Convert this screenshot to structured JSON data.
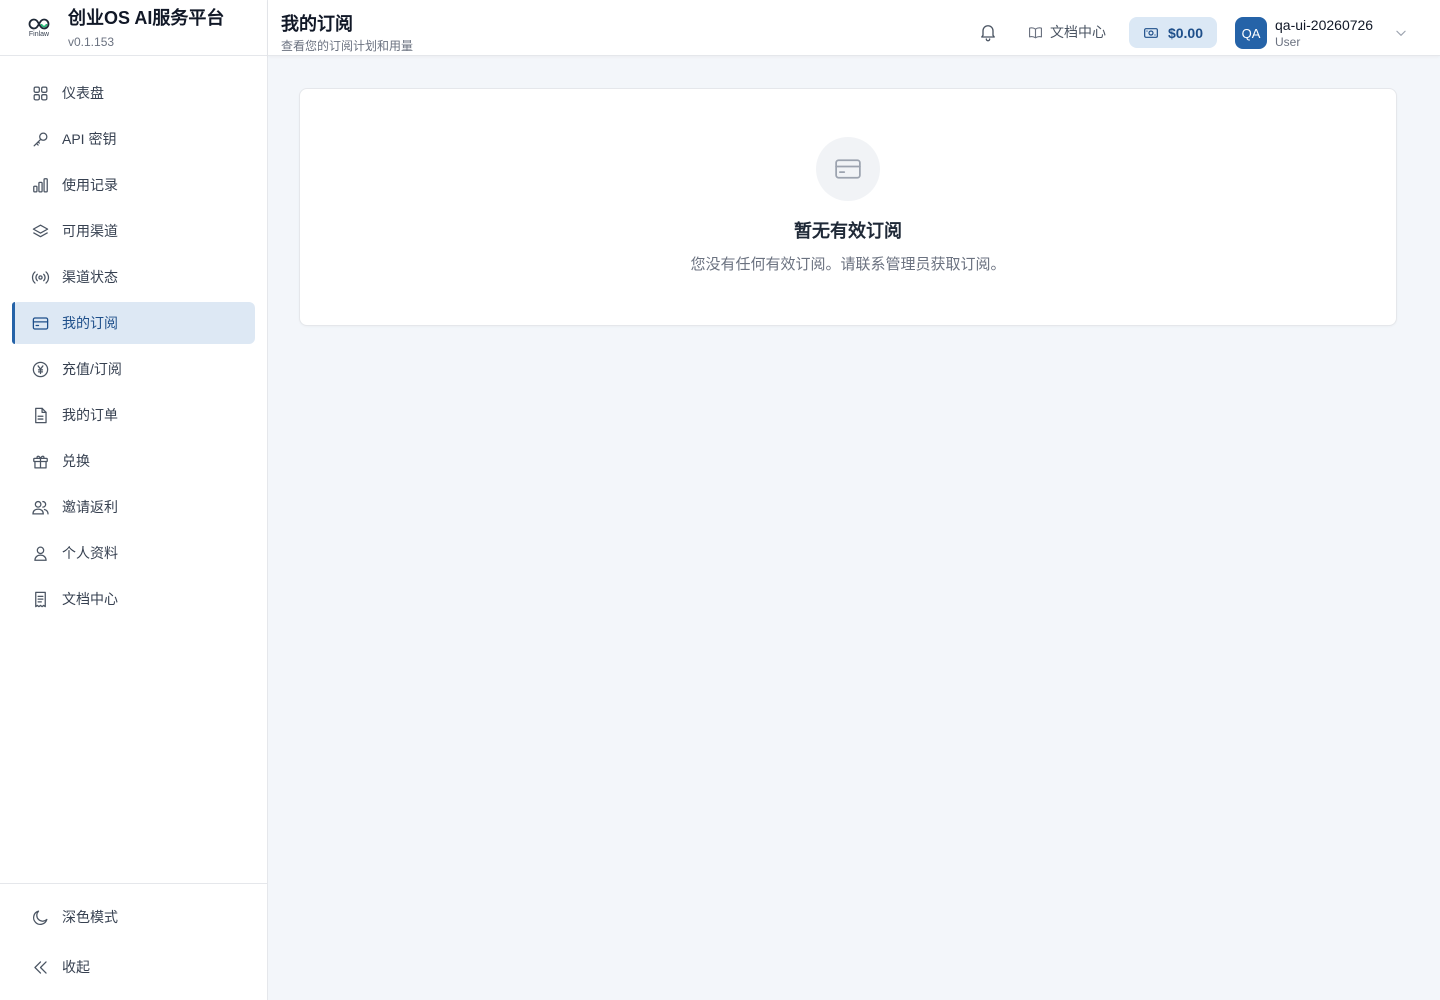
{
  "brand": {
    "logo_text": "Finlaw",
    "title": "创业OS AI服务平台",
    "version": "v0.1.153"
  },
  "sidebar": {
    "items": [
      {
        "label": "仪表盘",
        "icon": "grid-icon"
      },
      {
        "label": "API 密钥",
        "icon": "key-icon"
      },
      {
        "label": "使用记录",
        "icon": "bar-chart-icon"
      },
      {
        "label": "可用渠道",
        "icon": "layers-icon"
      },
      {
        "label": "渠道状态",
        "icon": "radio-icon"
      },
      {
        "label": "我的订阅",
        "icon": "credit-card-icon",
        "active": true
      },
      {
        "label": "充值/订阅",
        "icon": "yen-circle-icon"
      },
      {
        "label": "我的订单",
        "icon": "file-icon"
      },
      {
        "label": "兑换",
        "icon": "gift-icon"
      },
      {
        "label": "邀请返利",
        "icon": "users-icon"
      },
      {
        "label": "个人资料",
        "icon": "user-icon"
      },
      {
        "label": "文档中心",
        "icon": "receipt-icon"
      }
    ],
    "footer": {
      "dark_mode": "深色模式",
      "collapse": "收起"
    }
  },
  "header": {
    "title": "我的订阅",
    "subtitle": "查看您的订阅计划和用量",
    "docs_label": "文档中心",
    "balance": "$0.00",
    "user": {
      "initials": "QA",
      "name": "qa-ui-20260726",
      "role": "User"
    }
  },
  "main": {
    "empty_title": "暂无有效订阅",
    "empty_desc": "您没有任何有效订阅。请联系管理员获取订阅。"
  },
  "colors": {
    "accent": "#2563a8",
    "active_bg": "#dde8f4",
    "balance_bg": "#dbe8f5",
    "page_bg": "#f3f6fa"
  }
}
